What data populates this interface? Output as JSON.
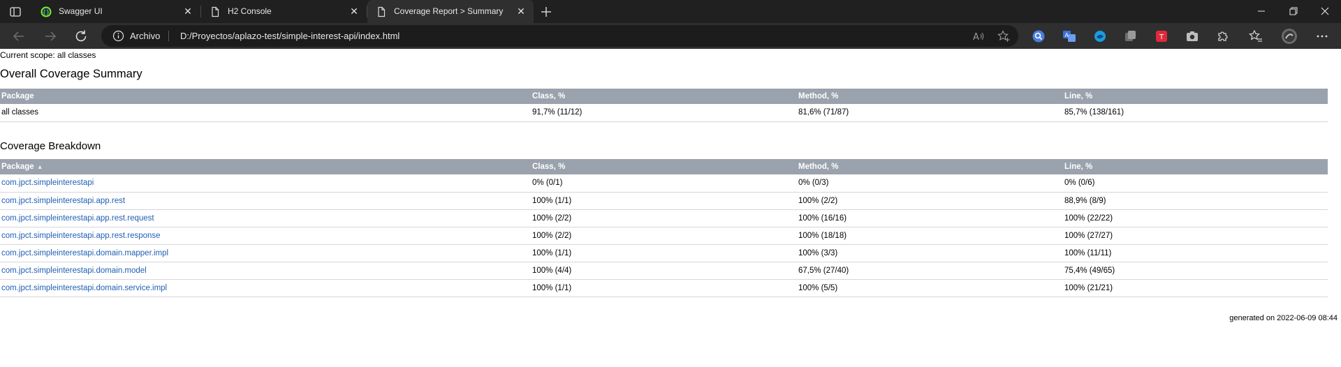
{
  "browser": {
    "tabs": [
      {
        "title": "Swagger UI",
        "icon": "swagger-icon"
      },
      {
        "title": "H2 Console",
        "icon": "page-icon"
      },
      {
        "title": "Coverage Report > Summary",
        "icon": "page-icon",
        "active": true
      }
    ],
    "address": {
      "site_label": "Archivo",
      "url": "D:/Proyectos/aplazo-test/simple-interest-api/index.html"
    }
  },
  "report": {
    "scope": "Current scope: all classes",
    "overall_title": "Overall Coverage Summary",
    "breakdown_title": "Coverage Breakdown",
    "headers": {
      "package": "Package",
      "class": "Class, %",
      "method": "Method, %",
      "line": "Line, %"
    },
    "overall": {
      "package": "all classes",
      "class": "91,7% (11/12)",
      "method": "81,6% (71/87)",
      "line": "85,7% (138/161)"
    },
    "rows": [
      {
        "package": "com.jpct.simpleinterestapi",
        "class": "0% (0/1)",
        "method": "0% (0/3)",
        "line": "0% (0/6)"
      },
      {
        "package": "com.jpct.simpleinterestapi.app.rest",
        "class": "100% (1/1)",
        "method": "100% (2/2)",
        "line": "88,9% (8/9)"
      },
      {
        "package": "com.jpct.simpleinterestapi.app.rest.request",
        "class": "100% (2/2)",
        "method": "100% (16/16)",
        "line": "100% (22/22)"
      },
      {
        "package": "com.jpct.simpleinterestapi.app.rest.response",
        "class": "100% (2/2)",
        "method": "100% (18/18)",
        "line": "100% (27/27)"
      },
      {
        "package": "com.jpct.simpleinterestapi.domain.mapper.impl",
        "class": "100% (1/1)",
        "method": "100% (3/3)",
        "line": "100% (11/11)"
      },
      {
        "package": "com.jpct.simpleinterestapi.domain.model",
        "class": "100% (4/4)",
        "method": "67,5% (27/40)",
        "line": "75,4% (49/65)"
      },
      {
        "package": "com.jpct.simpleinterestapi.domain.service.impl",
        "class": "100% (1/1)",
        "method": "100% (5/5)",
        "line": "100% (21/21)"
      }
    ],
    "footer": "generated on 2022-06-09 08:44"
  }
}
